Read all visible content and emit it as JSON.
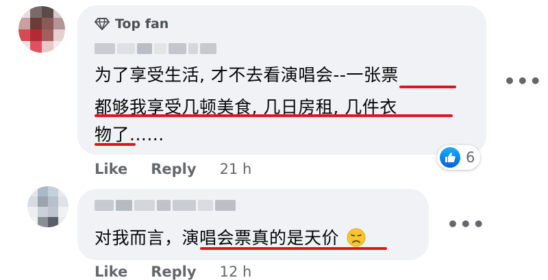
{
  "comments": [
    {
      "badge": "Top fan",
      "lines": [
        "为了享受生活, 才不去看演唱会--一张票",
        "都够我享受几顿美食, 几日房租, 几件衣",
        "物了......"
      ],
      "actions": {
        "like": "Like",
        "reply": "Reply",
        "time": "21 h"
      },
      "reaction": {
        "icon": "thumbs-up-icon",
        "count": "6"
      },
      "more": "•••"
    },
    {
      "text": "对我而言，演唱会票真的是天价",
      "emoji": "disappointed-face-icon",
      "actions": {
        "like": "Like",
        "reply": "Reply",
        "time": "12 h"
      },
      "more": "•••"
    }
  ],
  "colors": {
    "bubble": "#f0f2f5",
    "underline": "#e0141e",
    "meta": "#65676b",
    "like_blue": "#1877f2"
  }
}
